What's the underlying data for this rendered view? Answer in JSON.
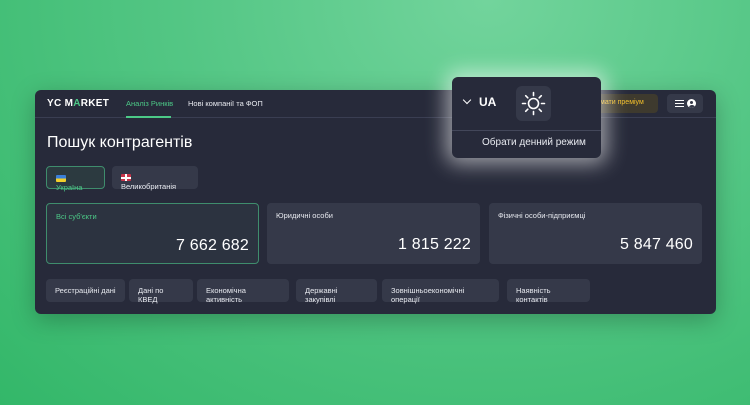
{
  "header": {
    "logo_text_pre": "YC M",
    "logo_text_accent": "A",
    "logo_text_post": "RKET",
    "nav": [
      {
        "label": "Аналіз Ринків",
        "active": true
      },
      {
        "label": "Нові компанії та ФОП",
        "active": false
      }
    ],
    "premium_label": "мати преміум",
    "menu_icon": "hamburger-icon",
    "user_icon": "user-icon"
  },
  "popup": {
    "language": "UA",
    "theme_icon": "sun-icon",
    "tooltip": "Обрати денний режим"
  },
  "main": {
    "title": "Пошук контрагентів",
    "countries": [
      {
        "label": "Україна",
        "flag": "ua-flag-icon",
        "active": true
      },
      {
        "label": "Великобританія",
        "flag": "gb-flag-icon",
        "active": false
      }
    ],
    "stats": [
      {
        "label": "Всі суб'єкти",
        "value": "7 662 682",
        "active": true
      },
      {
        "label": "Юридичні особи",
        "value": "1 815 222",
        "active": false
      },
      {
        "label": "Фізичні особи-підприємці",
        "value": "5 847 460",
        "active": false
      }
    ],
    "tags": [
      "Реєстраційні дані",
      "Дані по КВЕД",
      "Економічна активність",
      "Державні закупівлі",
      "Зовнішньоекономічні операції",
      "Наявність контактів"
    ]
  },
  "colors": {
    "accent": "#4cc987",
    "premium": "#f3c02b",
    "panel": "#272a3a",
    "card": "#353949",
    "background": "#4fc37f"
  }
}
